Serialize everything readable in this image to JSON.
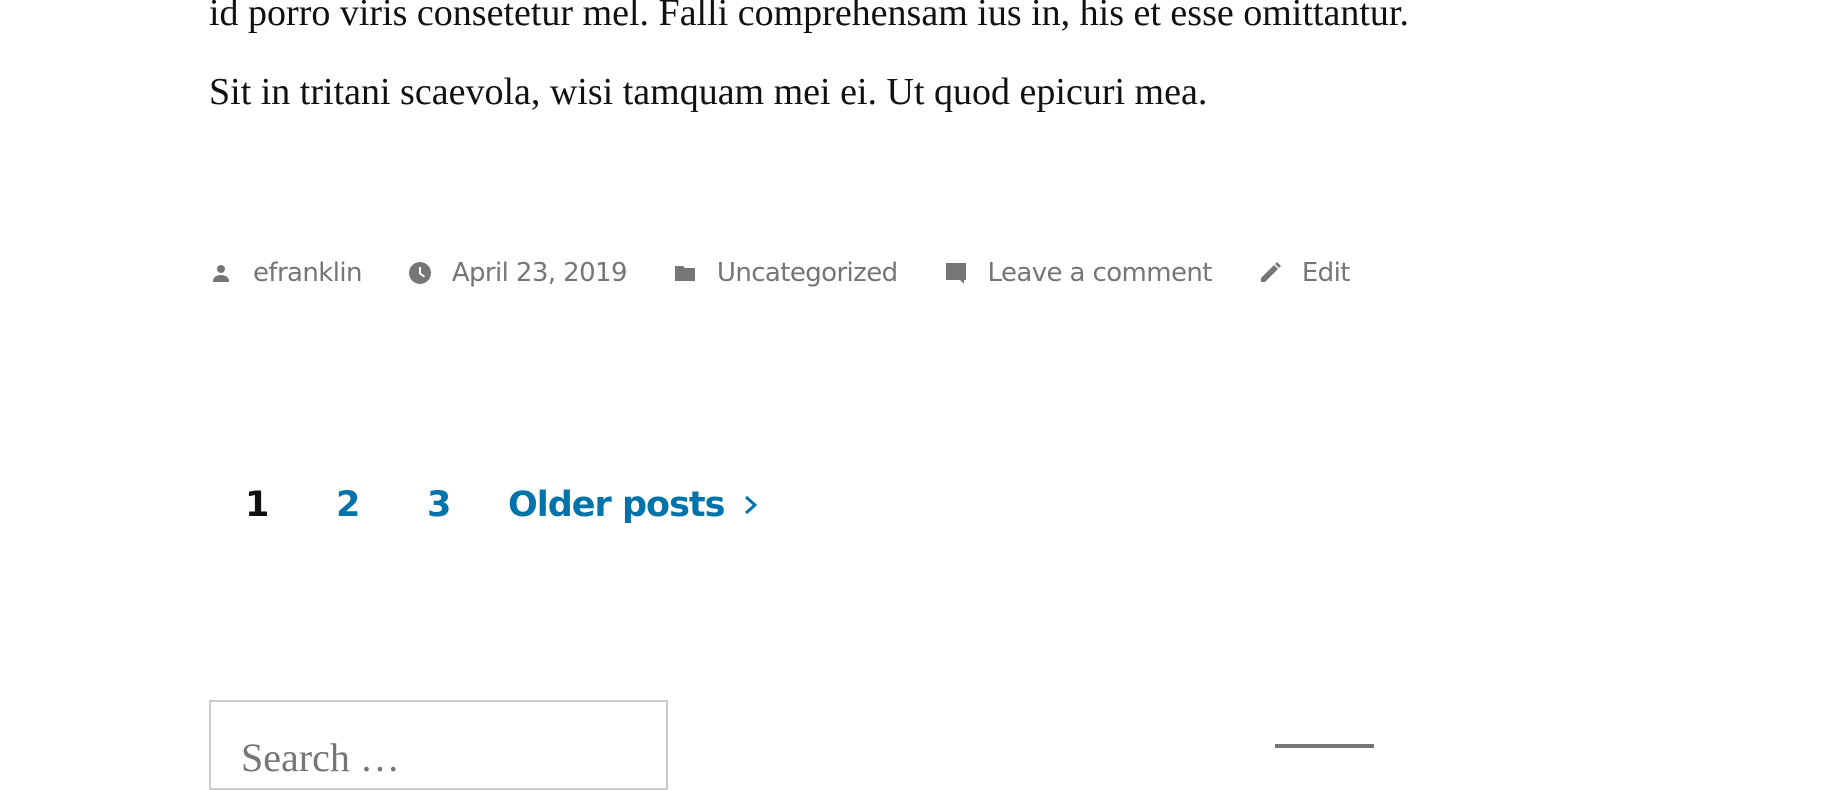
{
  "post": {
    "paragraph_lines": [
      "id porro viris consetetur mel. Falli comprehensam ius in, his et esse omittantur.",
      "Sit in tritani scaevola, wisi tamquam mei ei. Ut quod epicuri mea."
    ],
    "meta": {
      "author": {
        "icon": "person-icon",
        "label": "efranklin"
      },
      "date": {
        "icon": "clock-icon",
        "label": "April 23, 2019"
      },
      "category": {
        "icon": "folder-icon",
        "label": "Uncategorized"
      },
      "comments": {
        "icon": "comment-icon",
        "label": "Leave a comment"
      },
      "edit": {
        "icon": "pencil-icon",
        "label": "Edit"
      }
    }
  },
  "pagination": {
    "current_page": "1",
    "pages": [
      "1",
      "2",
      "3"
    ],
    "older_label": "Older posts",
    "older_icon": "chevron-right-icon",
    "current_color": "#111111",
    "link_color": "#0073aa"
  },
  "search": {
    "value": "",
    "placeholder": "Search …"
  },
  "colors": {
    "meta_text": "#767676",
    "body_text": "#111111",
    "accent": "#0073aa",
    "input_border": "#cccccc"
  }
}
